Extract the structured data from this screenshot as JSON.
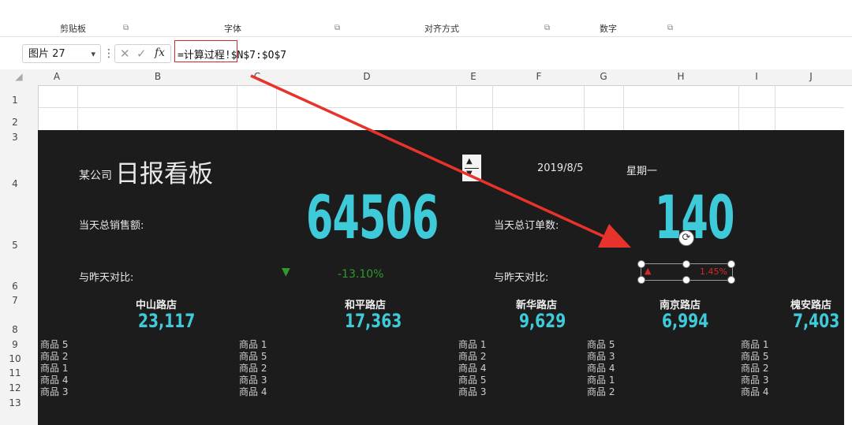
{
  "ribbon": {
    "groups": [
      "剪贴板",
      "字体",
      "对齐方式",
      "数字"
    ]
  },
  "formula_bar": {
    "name_box": "图片 27",
    "formula": "=计算过程!$N$7:$O$7",
    "fx": "fx"
  },
  "columns": [
    "A",
    "B",
    "C",
    "D",
    "E",
    "F",
    "G",
    "H",
    "I",
    "J"
  ],
  "rows": [
    "1",
    "2",
    "3",
    "4",
    "5",
    "6",
    "7",
    "8",
    "9",
    "10",
    "11",
    "12",
    "13"
  ],
  "dashboard": {
    "company": "某公司",
    "title": "日报看板",
    "date": "2019/8/5",
    "weekday": "星期一",
    "sales_label": "当天总销售额:",
    "sales_value": "64506",
    "orders_label": "当天总订单数:",
    "orders_value": "140",
    "compare_label": "与昨天对比:",
    "sales_change": "-13.10%",
    "orders_change": "1.45%",
    "colors": {
      "accent": "#3ecad8",
      "down": "#2e9a2e",
      "up": "#d42a2a",
      "background": "#1c1c1c"
    },
    "stores": [
      {
        "name": "中山路店",
        "value": "23,117",
        "products": [
          "商品 5",
          "商品 2",
          "商品 1",
          "商品 4",
          "商品 3"
        ]
      },
      {
        "name": "和平路店",
        "value": "17,363",
        "products": [
          "商品 1",
          "商品 5",
          "商品 2",
          "商品 3",
          "商品 4"
        ]
      },
      {
        "name": "新华路店",
        "value": "9,629",
        "products": [
          "商品 1",
          "商品 2",
          "商品 4",
          "商品 5",
          "商品 3"
        ]
      },
      {
        "name": "南京路店",
        "value": "6,994",
        "products": [
          "商品 5",
          "商品 3",
          "商品 4",
          "商品 1",
          "商品 2"
        ]
      },
      {
        "name": "槐安路店",
        "value": "7,403",
        "products": [
          "商品 1",
          "商品 5",
          "商品 2",
          "商品 3",
          "商品 4"
        ]
      }
    ]
  }
}
